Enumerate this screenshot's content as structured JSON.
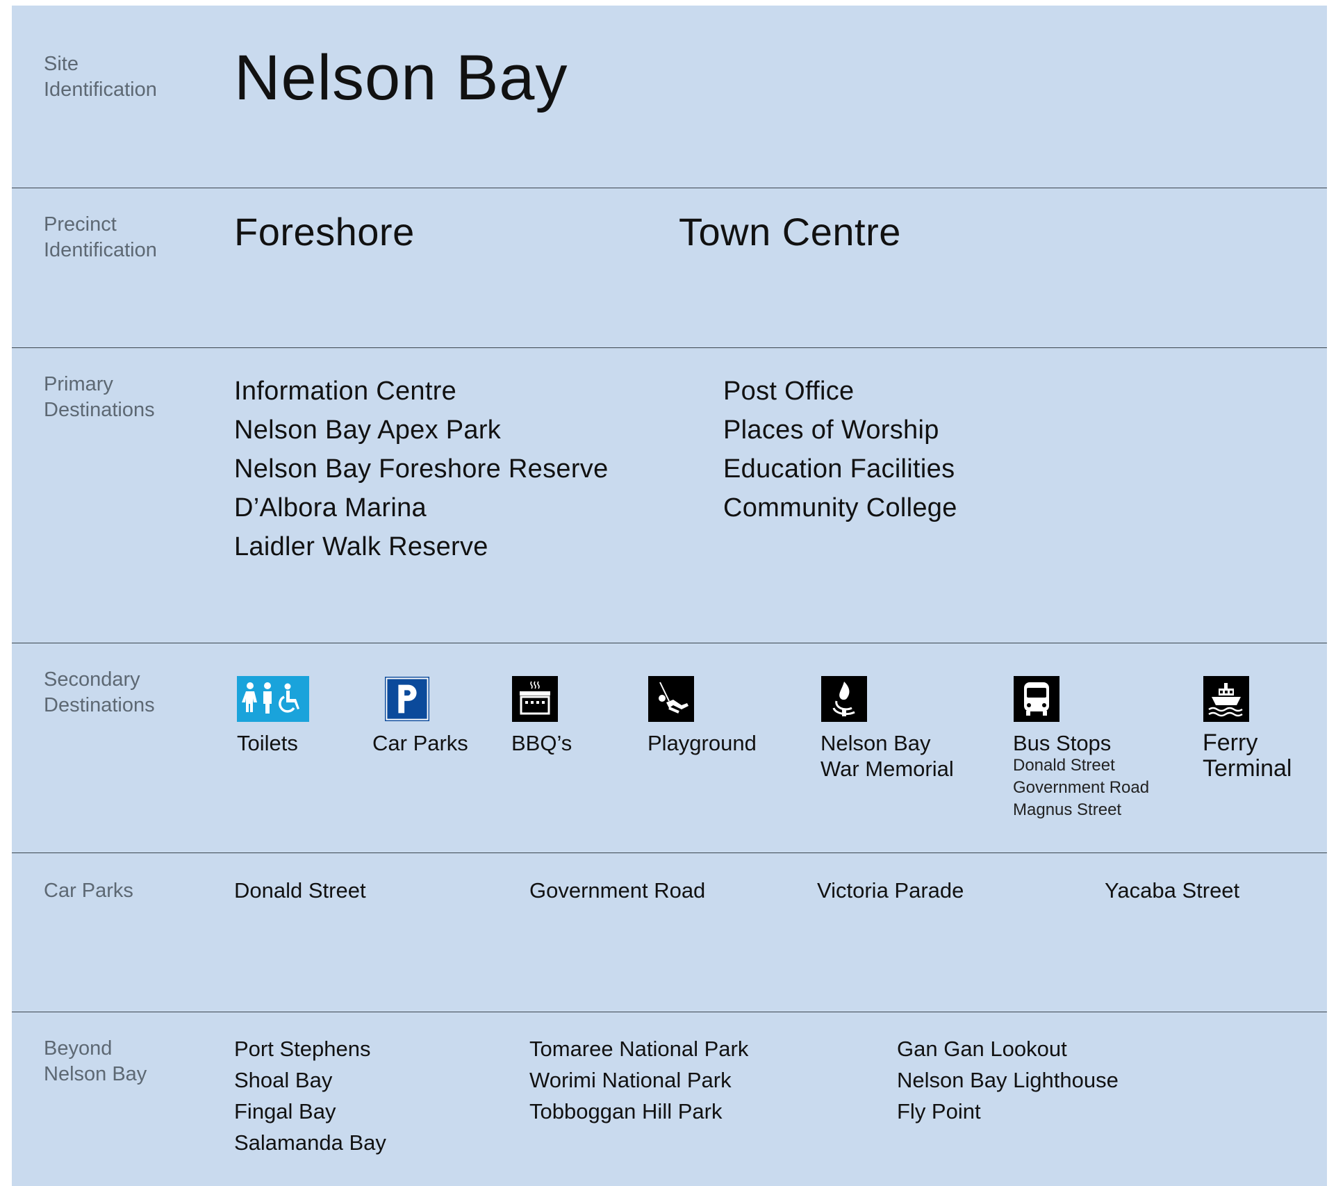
{
  "site": {
    "label_line1": "Site",
    "label_line2": "Identification",
    "title": "Nelson Bay"
  },
  "precinct": {
    "label_line1": "Precinct",
    "label_line2": "Identification",
    "items": [
      "Foreshore",
      "Town Centre"
    ]
  },
  "primary": {
    "label_line1": "Primary",
    "label_line2": "Destinations",
    "col1": [
      "Information Centre",
      "Nelson Bay Apex Park",
      "Nelson Bay Foreshore Reserve",
      "D’Albora Marina",
      "Laidler Walk Reserve"
    ],
    "col2": [
      "Post Office",
      "Places of Worship",
      "Education Facilities",
      "Community College"
    ]
  },
  "secondary": {
    "label_line1": "Secondary",
    "label_line2": "Destinations",
    "items": [
      {
        "icon": "toilets-icon",
        "label": "Toilets"
      },
      {
        "icon": "parking-icon",
        "label": "Car Parks"
      },
      {
        "icon": "bbq-icon",
        "label": "BBQ’s"
      },
      {
        "icon": "playground-icon",
        "label": "Playground"
      },
      {
        "icon": "war-memorial-icon",
        "label_line1": "Nelson Bay",
        "label_line2": "War Memorial"
      },
      {
        "icon": "bus-icon",
        "label": "Bus Stops",
        "subs": [
          "Donald Street",
          "Government Road",
          "Magnus Street"
        ]
      },
      {
        "icon": "ferry-icon",
        "label_line1": "Ferry",
        "label_line2": "Terminal"
      }
    ],
    "colors": {
      "toilets_bg": "#1aa3db",
      "parking_bg": "#0b4a9b",
      "icon_dark": "#000000"
    }
  },
  "car_parks": {
    "label": "Car Parks",
    "items": [
      "Donald Street",
      "Government Road",
      "Victoria Parade",
      "Yacaba Street"
    ]
  },
  "beyond": {
    "label_line1": "Beyond",
    "label_line2": "Nelson Bay",
    "col1": [
      "Port Stephens",
      "Shoal Bay",
      "Fingal Bay",
      "Salamanda Bay"
    ],
    "col2": [
      "Tomaree National Park",
      "Worimi National Park",
      "Tobboggan Hill Park"
    ],
    "col3": [
      "Gan Gan Lookout",
      "Nelson Bay Lighthouse",
      "Fly Point"
    ]
  },
  "colors": {
    "background": "#c9daee",
    "rule": "#3c4650",
    "label_text": "#5d6873",
    "text": "#111111"
  }
}
